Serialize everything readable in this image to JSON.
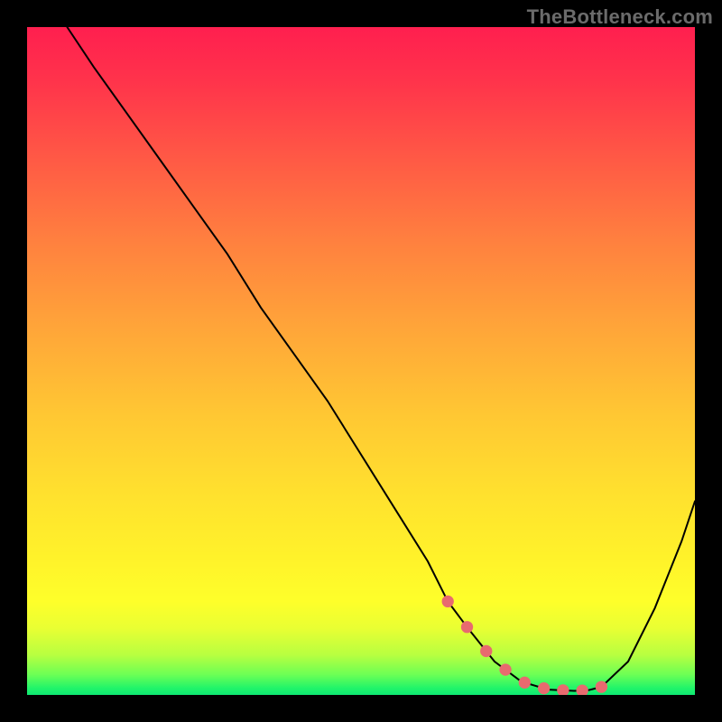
{
  "watermark": "TheBottleneck.com",
  "chart_data": {
    "type": "line",
    "title": "",
    "xlabel": "",
    "ylabel": "",
    "xlim": [
      0,
      100
    ],
    "ylim": [
      0,
      100
    ],
    "x": [
      6,
      10,
      15,
      20,
      25,
      30,
      35,
      40,
      45,
      50,
      55,
      60,
      63,
      66,
      70,
      74,
      78,
      82,
      84,
      86,
      90,
      94,
      98,
      100
    ],
    "y": [
      100,
      94,
      87,
      80,
      73,
      66,
      58,
      51,
      44,
      36,
      28,
      20,
      14,
      10,
      5,
      2,
      0.8,
      0.6,
      0.7,
      1.2,
      5,
      13,
      23,
      29
    ],
    "marker_region": {
      "x_start": 63,
      "x_end": 86
    },
    "gradient_stops": [
      {
        "pos": 0,
        "color": "#ff1f4f"
      },
      {
        "pos": 8,
        "color": "#ff334b"
      },
      {
        "pos": 20,
        "color": "#ff5a45"
      },
      {
        "pos": 32,
        "color": "#ff803f"
      },
      {
        "pos": 45,
        "color": "#ffa539"
      },
      {
        "pos": 58,
        "color": "#ffc733"
      },
      {
        "pos": 70,
        "color": "#ffe12e"
      },
      {
        "pos": 80,
        "color": "#fff32a"
      },
      {
        "pos": 86,
        "color": "#feff2a"
      },
      {
        "pos": 90,
        "color": "#e9ff33"
      },
      {
        "pos": 94,
        "color": "#b8ff40"
      },
      {
        "pos": 97,
        "color": "#6bff55"
      },
      {
        "pos": 99,
        "color": "#20f46a"
      },
      {
        "pos": 100,
        "color": "#0ee872"
      }
    ],
    "marker_color": "#e86a6f",
    "line_color": "#000000",
    "background_outside": "#000000"
  }
}
